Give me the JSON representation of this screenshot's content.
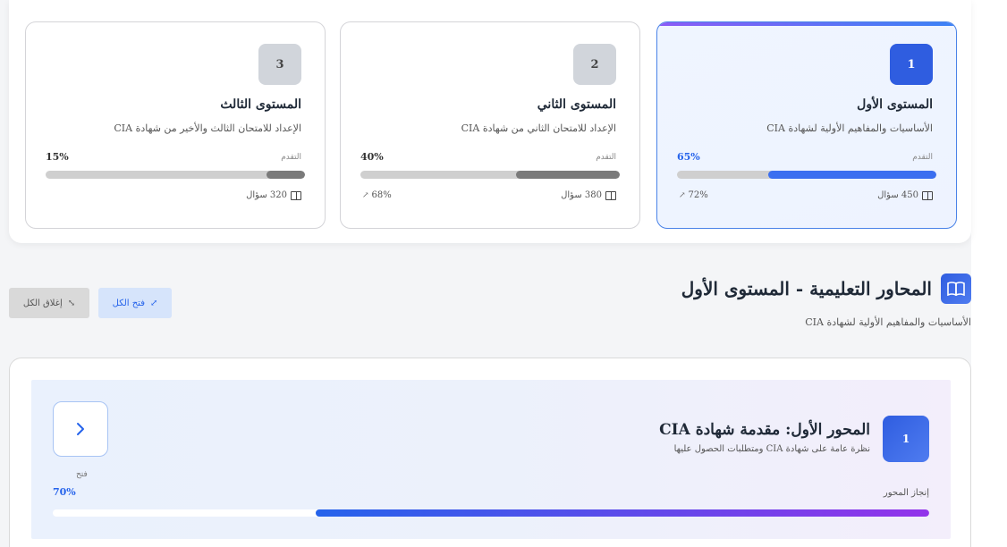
{
  "levels": [
    {
      "number": "1",
      "title": "المستوى الأول",
      "description": "الأساسيات والمفاهيم الأولية لشهادة CIA",
      "progress_label": "التقدم",
      "progress_value": "65%",
      "progress_fraction": 0.65,
      "questions": "450 سؤال",
      "rate": "72%",
      "active": true
    },
    {
      "number": "2",
      "title": "المستوى الثاني",
      "description": "الإعداد للامتحان الثاني من شهادة CIA",
      "progress_label": "التقدم",
      "progress_value": "40%",
      "progress_fraction": 0.4,
      "questions": "380 سؤال",
      "rate": "68%",
      "active": false
    },
    {
      "number": "3",
      "title": "المستوى الثالث",
      "description": "الإعداد للامتحان الثالث والأخير من شهادة CIA",
      "progress_label": "التقدم",
      "progress_value": "15%",
      "progress_fraction": 0.15,
      "questions": "320 سؤال",
      "rate": "",
      "active": false
    }
  ],
  "section": {
    "title": "المحاور التعليمية - المستوى الأول",
    "subtitle": "الأساسيات والمفاهيم الأولية لشهادة CIA",
    "expand_all_label": "فتح الكل",
    "collapse_all_label": "إغلاق الكل"
  },
  "axes": [
    {
      "number": "1",
      "title": "المحور الأول: مقدمة شهادة CIA",
      "description": "نظرة عامة على شهادة CIA ومتطلبات الحصول عليها",
      "open_label": "فتح",
      "completion_label": "إنجاز المحور",
      "completion_value": "70%",
      "completion_fraction": 0.7
    }
  ],
  "colors": {
    "accent": "#2f5de0",
    "accent_light": "#3b6ff0",
    "muted_bar": "#7a7a7a",
    "gradient_end": "#9333ea"
  }
}
